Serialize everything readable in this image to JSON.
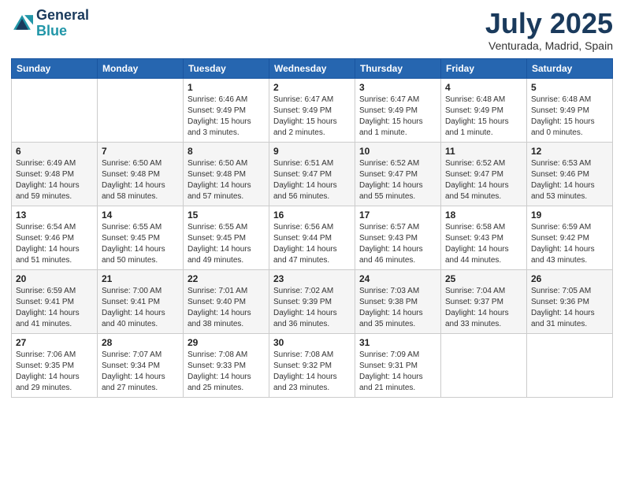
{
  "logo": {
    "line1": "General",
    "line2": "Blue"
  },
  "title": "July 2025",
  "subtitle": "Venturada, Madrid, Spain",
  "weekdays": [
    "Sunday",
    "Monday",
    "Tuesday",
    "Wednesday",
    "Thursday",
    "Friday",
    "Saturday"
  ],
  "weeks": [
    [
      {
        "day": "",
        "sunrise": "",
        "sunset": "",
        "daylight": ""
      },
      {
        "day": "",
        "sunrise": "",
        "sunset": "",
        "daylight": ""
      },
      {
        "day": "1",
        "sunrise": "Sunrise: 6:46 AM",
        "sunset": "Sunset: 9:49 PM",
        "daylight": "Daylight: 15 hours and 3 minutes."
      },
      {
        "day": "2",
        "sunrise": "Sunrise: 6:47 AM",
        "sunset": "Sunset: 9:49 PM",
        "daylight": "Daylight: 15 hours and 2 minutes."
      },
      {
        "day": "3",
        "sunrise": "Sunrise: 6:47 AM",
        "sunset": "Sunset: 9:49 PM",
        "daylight": "Daylight: 15 hours and 1 minute."
      },
      {
        "day": "4",
        "sunrise": "Sunrise: 6:48 AM",
        "sunset": "Sunset: 9:49 PM",
        "daylight": "Daylight: 15 hours and 1 minute."
      },
      {
        "day": "5",
        "sunrise": "Sunrise: 6:48 AM",
        "sunset": "Sunset: 9:49 PM",
        "daylight": "Daylight: 15 hours and 0 minutes."
      }
    ],
    [
      {
        "day": "6",
        "sunrise": "Sunrise: 6:49 AM",
        "sunset": "Sunset: 9:48 PM",
        "daylight": "Daylight: 14 hours and 59 minutes."
      },
      {
        "day": "7",
        "sunrise": "Sunrise: 6:50 AM",
        "sunset": "Sunset: 9:48 PM",
        "daylight": "Daylight: 14 hours and 58 minutes."
      },
      {
        "day": "8",
        "sunrise": "Sunrise: 6:50 AM",
        "sunset": "Sunset: 9:48 PM",
        "daylight": "Daylight: 14 hours and 57 minutes."
      },
      {
        "day": "9",
        "sunrise": "Sunrise: 6:51 AM",
        "sunset": "Sunset: 9:47 PM",
        "daylight": "Daylight: 14 hours and 56 minutes."
      },
      {
        "day": "10",
        "sunrise": "Sunrise: 6:52 AM",
        "sunset": "Sunset: 9:47 PM",
        "daylight": "Daylight: 14 hours and 55 minutes."
      },
      {
        "day": "11",
        "sunrise": "Sunrise: 6:52 AM",
        "sunset": "Sunset: 9:47 PM",
        "daylight": "Daylight: 14 hours and 54 minutes."
      },
      {
        "day": "12",
        "sunrise": "Sunrise: 6:53 AM",
        "sunset": "Sunset: 9:46 PM",
        "daylight": "Daylight: 14 hours and 53 minutes."
      }
    ],
    [
      {
        "day": "13",
        "sunrise": "Sunrise: 6:54 AM",
        "sunset": "Sunset: 9:46 PM",
        "daylight": "Daylight: 14 hours and 51 minutes."
      },
      {
        "day": "14",
        "sunrise": "Sunrise: 6:55 AM",
        "sunset": "Sunset: 9:45 PM",
        "daylight": "Daylight: 14 hours and 50 minutes."
      },
      {
        "day": "15",
        "sunrise": "Sunrise: 6:55 AM",
        "sunset": "Sunset: 9:45 PM",
        "daylight": "Daylight: 14 hours and 49 minutes."
      },
      {
        "day": "16",
        "sunrise": "Sunrise: 6:56 AM",
        "sunset": "Sunset: 9:44 PM",
        "daylight": "Daylight: 14 hours and 47 minutes."
      },
      {
        "day": "17",
        "sunrise": "Sunrise: 6:57 AM",
        "sunset": "Sunset: 9:43 PM",
        "daylight": "Daylight: 14 hours and 46 minutes."
      },
      {
        "day": "18",
        "sunrise": "Sunrise: 6:58 AM",
        "sunset": "Sunset: 9:43 PM",
        "daylight": "Daylight: 14 hours and 44 minutes."
      },
      {
        "day": "19",
        "sunrise": "Sunrise: 6:59 AM",
        "sunset": "Sunset: 9:42 PM",
        "daylight": "Daylight: 14 hours and 43 minutes."
      }
    ],
    [
      {
        "day": "20",
        "sunrise": "Sunrise: 6:59 AM",
        "sunset": "Sunset: 9:41 PM",
        "daylight": "Daylight: 14 hours and 41 minutes."
      },
      {
        "day": "21",
        "sunrise": "Sunrise: 7:00 AM",
        "sunset": "Sunset: 9:41 PM",
        "daylight": "Daylight: 14 hours and 40 minutes."
      },
      {
        "day": "22",
        "sunrise": "Sunrise: 7:01 AM",
        "sunset": "Sunset: 9:40 PM",
        "daylight": "Daylight: 14 hours and 38 minutes."
      },
      {
        "day": "23",
        "sunrise": "Sunrise: 7:02 AM",
        "sunset": "Sunset: 9:39 PM",
        "daylight": "Daylight: 14 hours and 36 minutes."
      },
      {
        "day": "24",
        "sunrise": "Sunrise: 7:03 AM",
        "sunset": "Sunset: 9:38 PM",
        "daylight": "Daylight: 14 hours and 35 minutes."
      },
      {
        "day": "25",
        "sunrise": "Sunrise: 7:04 AM",
        "sunset": "Sunset: 9:37 PM",
        "daylight": "Daylight: 14 hours and 33 minutes."
      },
      {
        "day": "26",
        "sunrise": "Sunrise: 7:05 AM",
        "sunset": "Sunset: 9:36 PM",
        "daylight": "Daylight: 14 hours and 31 minutes."
      }
    ],
    [
      {
        "day": "27",
        "sunrise": "Sunrise: 7:06 AM",
        "sunset": "Sunset: 9:35 PM",
        "daylight": "Daylight: 14 hours and 29 minutes."
      },
      {
        "day": "28",
        "sunrise": "Sunrise: 7:07 AM",
        "sunset": "Sunset: 9:34 PM",
        "daylight": "Daylight: 14 hours and 27 minutes."
      },
      {
        "day": "29",
        "sunrise": "Sunrise: 7:08 AM",
        "sunset": "Sunset: 9:33 PM",
        "daylight": "Daylight: 14 hours and 25 minutes."
      },
      {
        "day": "30",
        "sunrise": "Sunrise: 7:08 AM",
        "sunset": "Sunset: 9:32 PM",
        "daylight": "Daylight: 14 hours and 23 minutes."
      },
      {
        "day": "31",
        "sunrise": "Sunrise: 7:09 AM",
        "sunset": "Sunset: 9:31 PM",
        "daylight": "Daylight: 14 hours and 21 minutes."
      },
      {
        "day": "",
        "sunrise": "",
        "sunset": "",
        "daylight": ""
      },
      {
        "day": "",
        "sunrise": "",
        "sunset": "",
        "daylight": ""
      }
    ]
  ]
}
